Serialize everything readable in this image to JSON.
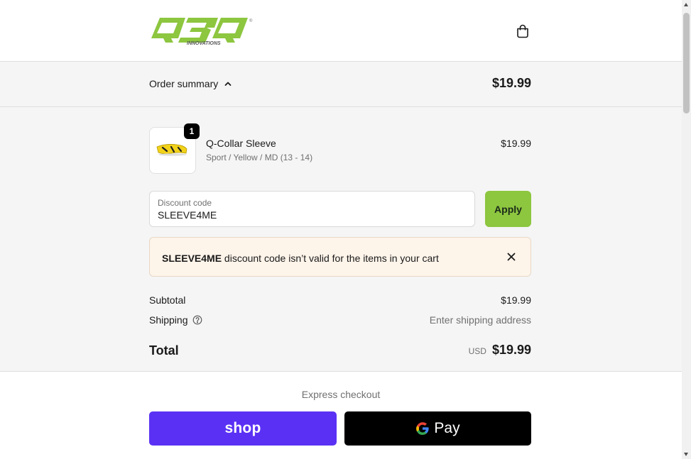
{
  "brand": {
    "logo_text": "Q3Q",
    "logo_subtext": "INNOVATIONS",
    "accent_color": "#8dc63f"
  },
  "header": {
    "cart_icon": "shopping-bag-icon"
  },
  "summary": {
    "toggle_label": "Order summary",
    "toggle_icon": "chevron-up-icon",
    "total": "$19.99"
  },
  "line_item": {
    "quantity": "1",
    "name": "Q-Collar Sleeve",
    "variant": "Sport / Yellow / MD (13 - 14)",
    "price": "$19.99"
  },
  "discount": {
    "label": "Discount code",
    "value": "SLEEVE4ME",
    "apply_label": "Apply"
  },
  "alert": {
    "code": "SLEEVE4ME",
    "message": " discount code isn’t valid for the items in your cart",
    "close_icon": "close-icon"
  },
  "totals": {
    "subtotal_label": "Subtotal",
    "subtotal_value": "$19.99",
    "shipping_label": "Shipping",
    "shipping_value": "Enter shipping address",
    "total_label": "Total",
    "currency": "USD",
    "total_value": "$19.99"
  },
  "express": {
    "title": "Express checkout",
    "shop_label": "shop",
    "gpay_label": "Pay",
    "shop_color": "#5a31f4"
  }
}
